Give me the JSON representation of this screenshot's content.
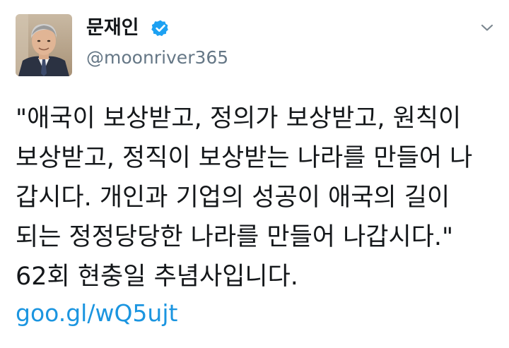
{
  "author": {
    "display_name": "문재인",
    "handle": "@moonriver365",
    "verified_icon": "verified-badge-icon",
    "avatar_icon": "profile-photo"
  },
  "menu": {
    "icon": "chevron-down-icon"
  },
  "tweet": {
    "lines": [
      "\"애국이 보상받고, 정의가 보상받고, 원칙이",
      "보상받고, 정직이 보상받는 나라를 만들어 나",
      "갑시다. 개인과 기업의 성공이 애국의 길이",
      "되는 정정당당한 나라를 만들어 나갑시다.\"",
      "62회 현충일 추념사입니다."
    ],
    "link": "goo.gl/wQ5ujt"
  },
  "colors": {
    "text": "#14171a",
    "secondary": "#657786",
    "link": "#1b95e0",
    "verified": "#1da1f2"
  }
}
